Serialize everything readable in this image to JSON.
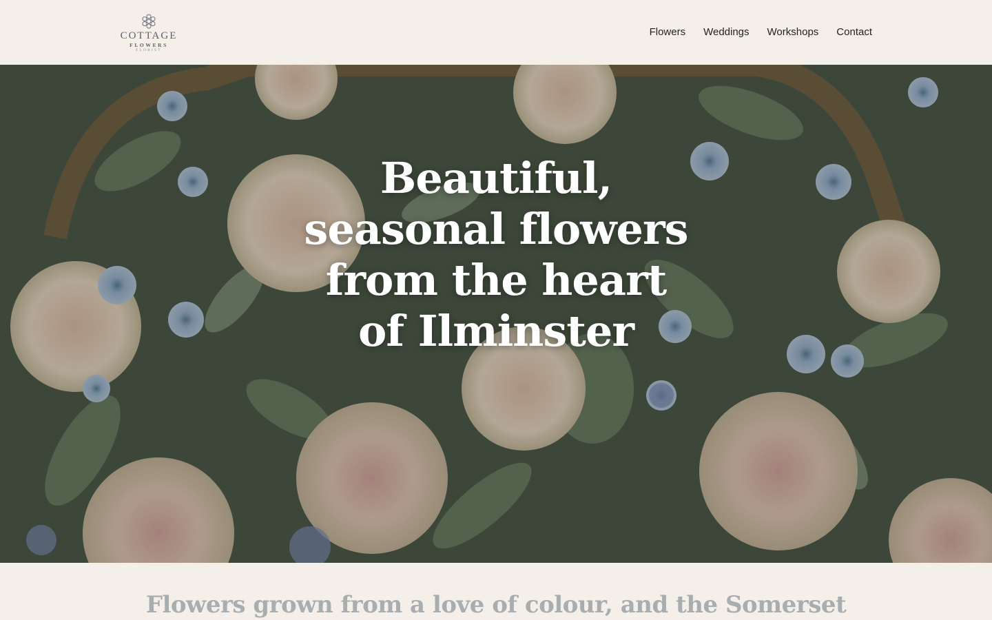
{
  "brand": {
    "line1": "COTTAGE",
    "line2": "FLOWERS",
    "line3": "FLORIST"
  },
  "nav": [
    {
      "label": "Flowers"
    },
    {
      "label": "Weddings"
    },
    {
      "label": "Workshops"
    },
    {
      "label": "Contact"
    }
  ],
  "hero": {
    "title_lines": [
      "Beautiful,",
      "seasonal flowers",
      "from the heart",
      "of Ilminster"
    ]
  },
  "intro": {
    "text": "Flowers grown from a love of colour, and the Somerset"
  },
  "colors": {
    "background": "#f5efe9",
    "hero_text": "#ffffff",
    "intro_text": "#a8adb0"
  },
  "icons": {
    "logo": "flower-emblem-icon"
  }
}
